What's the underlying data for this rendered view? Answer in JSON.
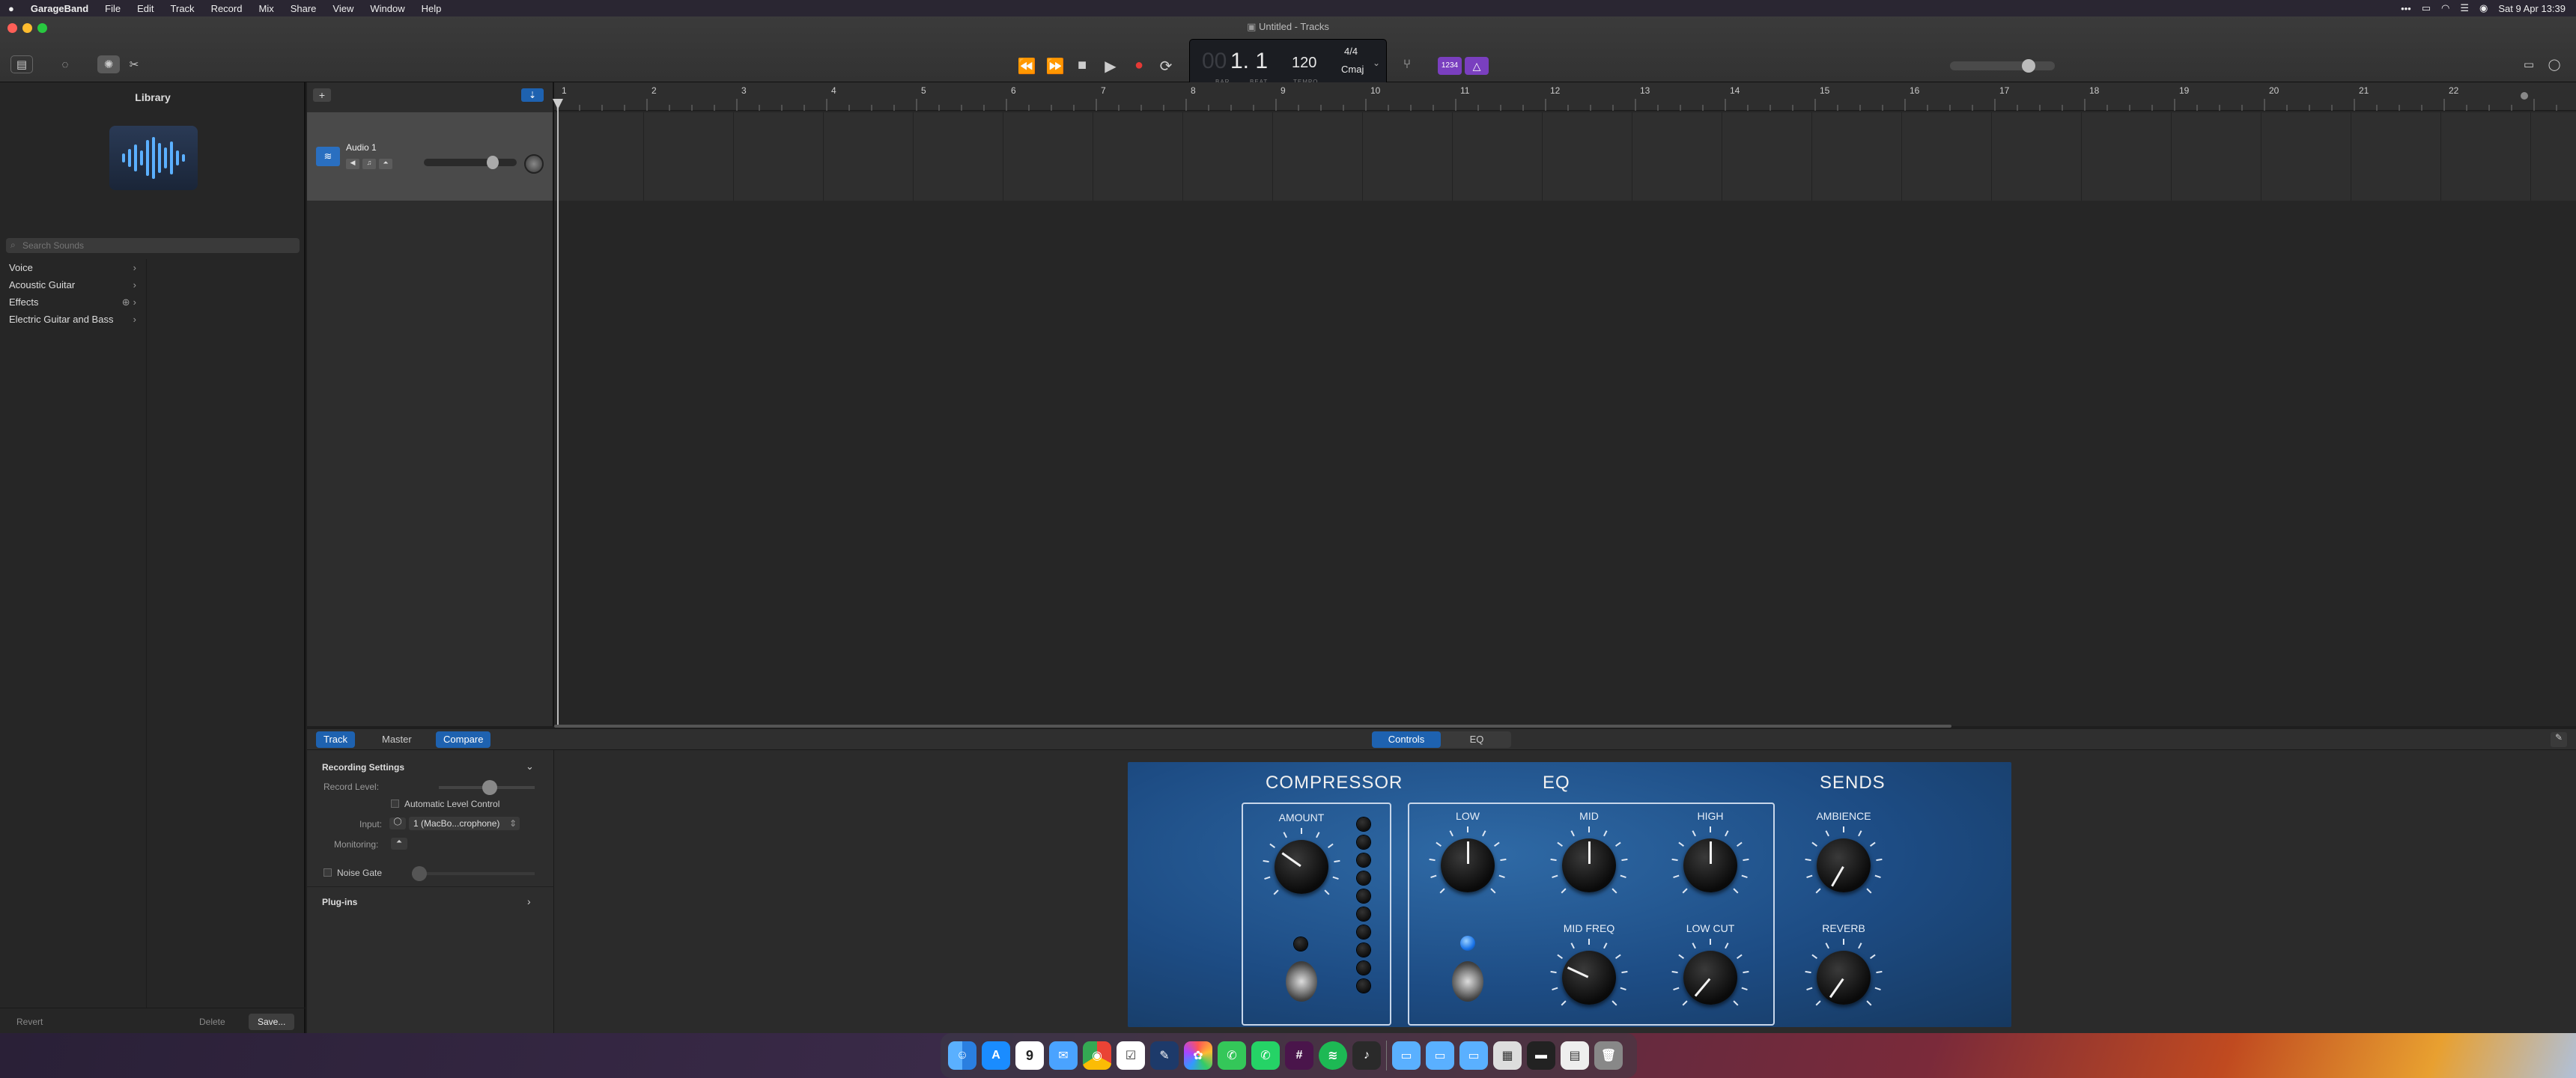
{
  "menubar": {
    "apple": "",
    "app": "GarageBand",
    "items": [
      "File",
      "Edit",
      "Track",
      "Record",
      "Mix",
      "Share",
      "View",
      "Window",
      "Help"
    ],
    "status": {
      "more": "•••",
      "datetime": "Sat 9 Apr 13:39"
    }
  },
  "window": {
    "title": "Untitled - Tracks"
  },
  "toolbar": {
    "library_icon": "library-icon",
    "help_icon": "help-icon",
    "smart_controls_icon": "smart-controls-icon",
    "editors_icon": "scissors-icon",
    "transport": {
      "rewind": "⏪",
      "forward": "⏩",
      "stop": "■",
      "play": "▶",
      "record": "●",
      "cycle": "⟳"
    },
    "lcd": {
      "bar_dim": "00",
      "position": "1. 1",
      "bar_label": "BAR",
      "beat_label": "BEAT",
      "tempo": "120",
      "tempo_label": "TEMPO",
      "signature": "4/4",
      "key": "Cmaj"
    },
    "tuner_icon": "tuner-icon",
    "count_in": "1234",
    "metronome_icon": "metronome-icon",
    "master_volume": 0.75,
    "notepad_icon": "notepad-icon",
    "loops_icon": "loops-icon"
  },
  "library": {
    "title": "Library",
    "search_placeholder": "Search Sounds",
    "items": [
      "Voice",
      "Acoustic Guitar",
      "Effects",
      "Electric Guitar and Bass"
    ],
    "buttons": {
      "revert": "Revert",
      "delete": "Delete",
      "save": "Save..."
    }
  },
  "tracks": {
    "add_label": "+",
    "list": [
      {
        "name": "Audio 1",
        "volume": 0.75
      }
    ],
    "ruler": [
      "1",
      "2",
      "3",
      "4",
      "5",
      "6",
      "7",
      "8",
      "9",
      "10",
      "11",
      "12",
      "13",
      "14",
      "15",
      "16",
      "17",
      "18",
      "19",
      "20",
      "21",
      "22"
    ]
  },
  "bottom": {
    "tabs_left": [
      "Track",
      "Master",
      "Compare"
    ],
    "tabs_center": [
      "Controls",
      "EQ"
    ],
    "recording": {
      "section": "Recording Settings",
      "record_level": "Record Level:",
      "record_level_value": 0.55,
      "auto_level": "Automatic Level Control",
      "input_label": "Input:",
      "input_value": "1 (MacBo...crophone)",
      "monitoring": "Monitoring:",
      "noise_gate": "Noise Gate",
      "plugins": "Plug-ins"
    },
    "amp": {
      "compressor": "COMPRESSOR",
      "eq": "EQ",
      "sends": "SENDS",
      "amount": "AMOUNT",
      "low": "LOW",
      "mid": "MID",
      "high": "HIGH",
      "mid_freq": "MID FREQ",
      "low_cut": "LOW CUT",
      "ambience": "AMBIENCE",
      "reverb": "REVERB"
    }
  },
  "dock": {
    "apps": [
      "Finder",
      "App Store",
      "Calendar",
      "Mail",
      "Chrome",
      "Reminders",
      "Notes",
      "Photos",
      "Messages",
      "WhatsApp",
      "Slack",
      "Spotify",
      "GarageBand",
      "Folder",
      "Folder",
      "Folder",
      "Window",
      "Window",
      "Window",
      "Trash"
    ],
    "calendar_day": "9"
  }
}
